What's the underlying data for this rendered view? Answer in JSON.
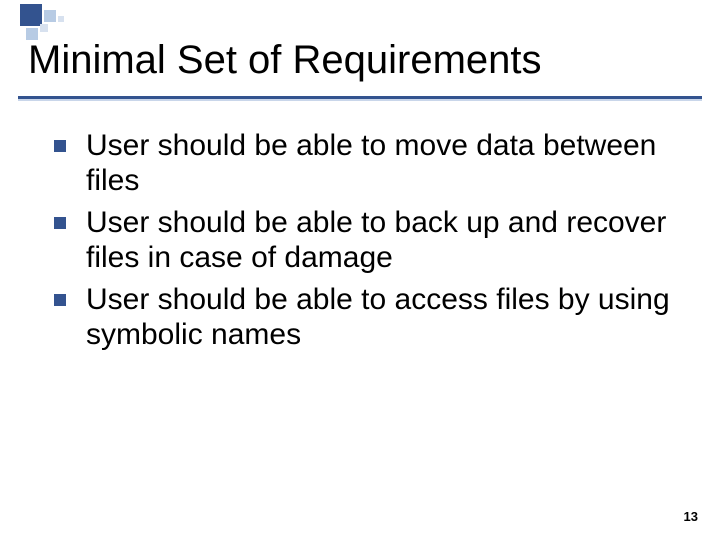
{
  "slide": {
    "title": "Minimal Set of Requirements",
    "bullets": [
      "User should be able to move data between files",
      "User should be able to back up and recover files in case of damage",
      "User should be able to access files by using symbolic names"
    ],
    "page_number": "13"
  }
}
